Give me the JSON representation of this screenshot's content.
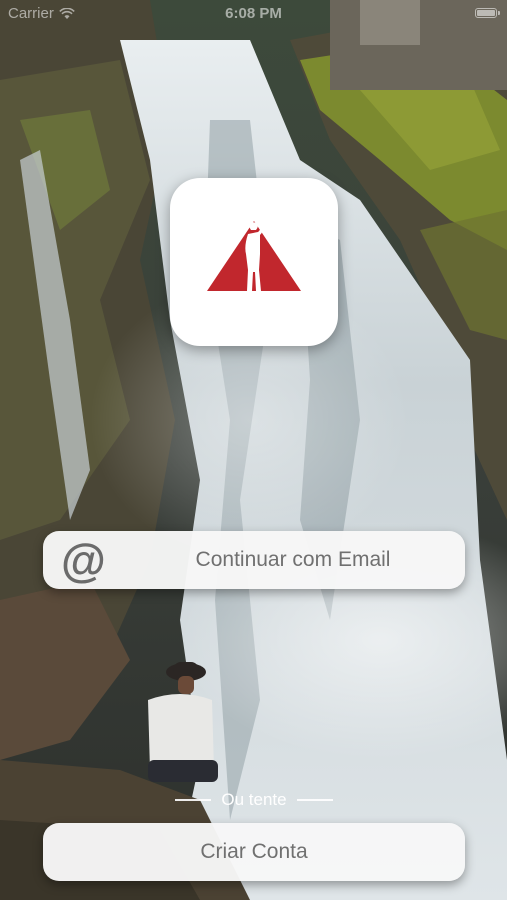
{
  "status_bar": {
    "carrier": "Carrier",
    "time": "6:08 PM",
    "icons": [
      "wifi-icon",
      "battery-icon"
    ]
  },
  "logo": {
    "icon": "mountain-hiker-logo",
    "color": "#c1272d"
  },
  "email_button": {
    "icon": "at-sign-icon",
    "icon_glyph": "@",
    "label": "Continuar com Email"
  },
  "divider": {
    "label": "Ou tente"
  },
  "create_account_button": {
    "label": "Criar Conta"
  },
  "colors": {
    "button_bg": "#f7f7f7",
    "button_text": "#707070",
    "brand_red": "#c1272d"
  }
}
